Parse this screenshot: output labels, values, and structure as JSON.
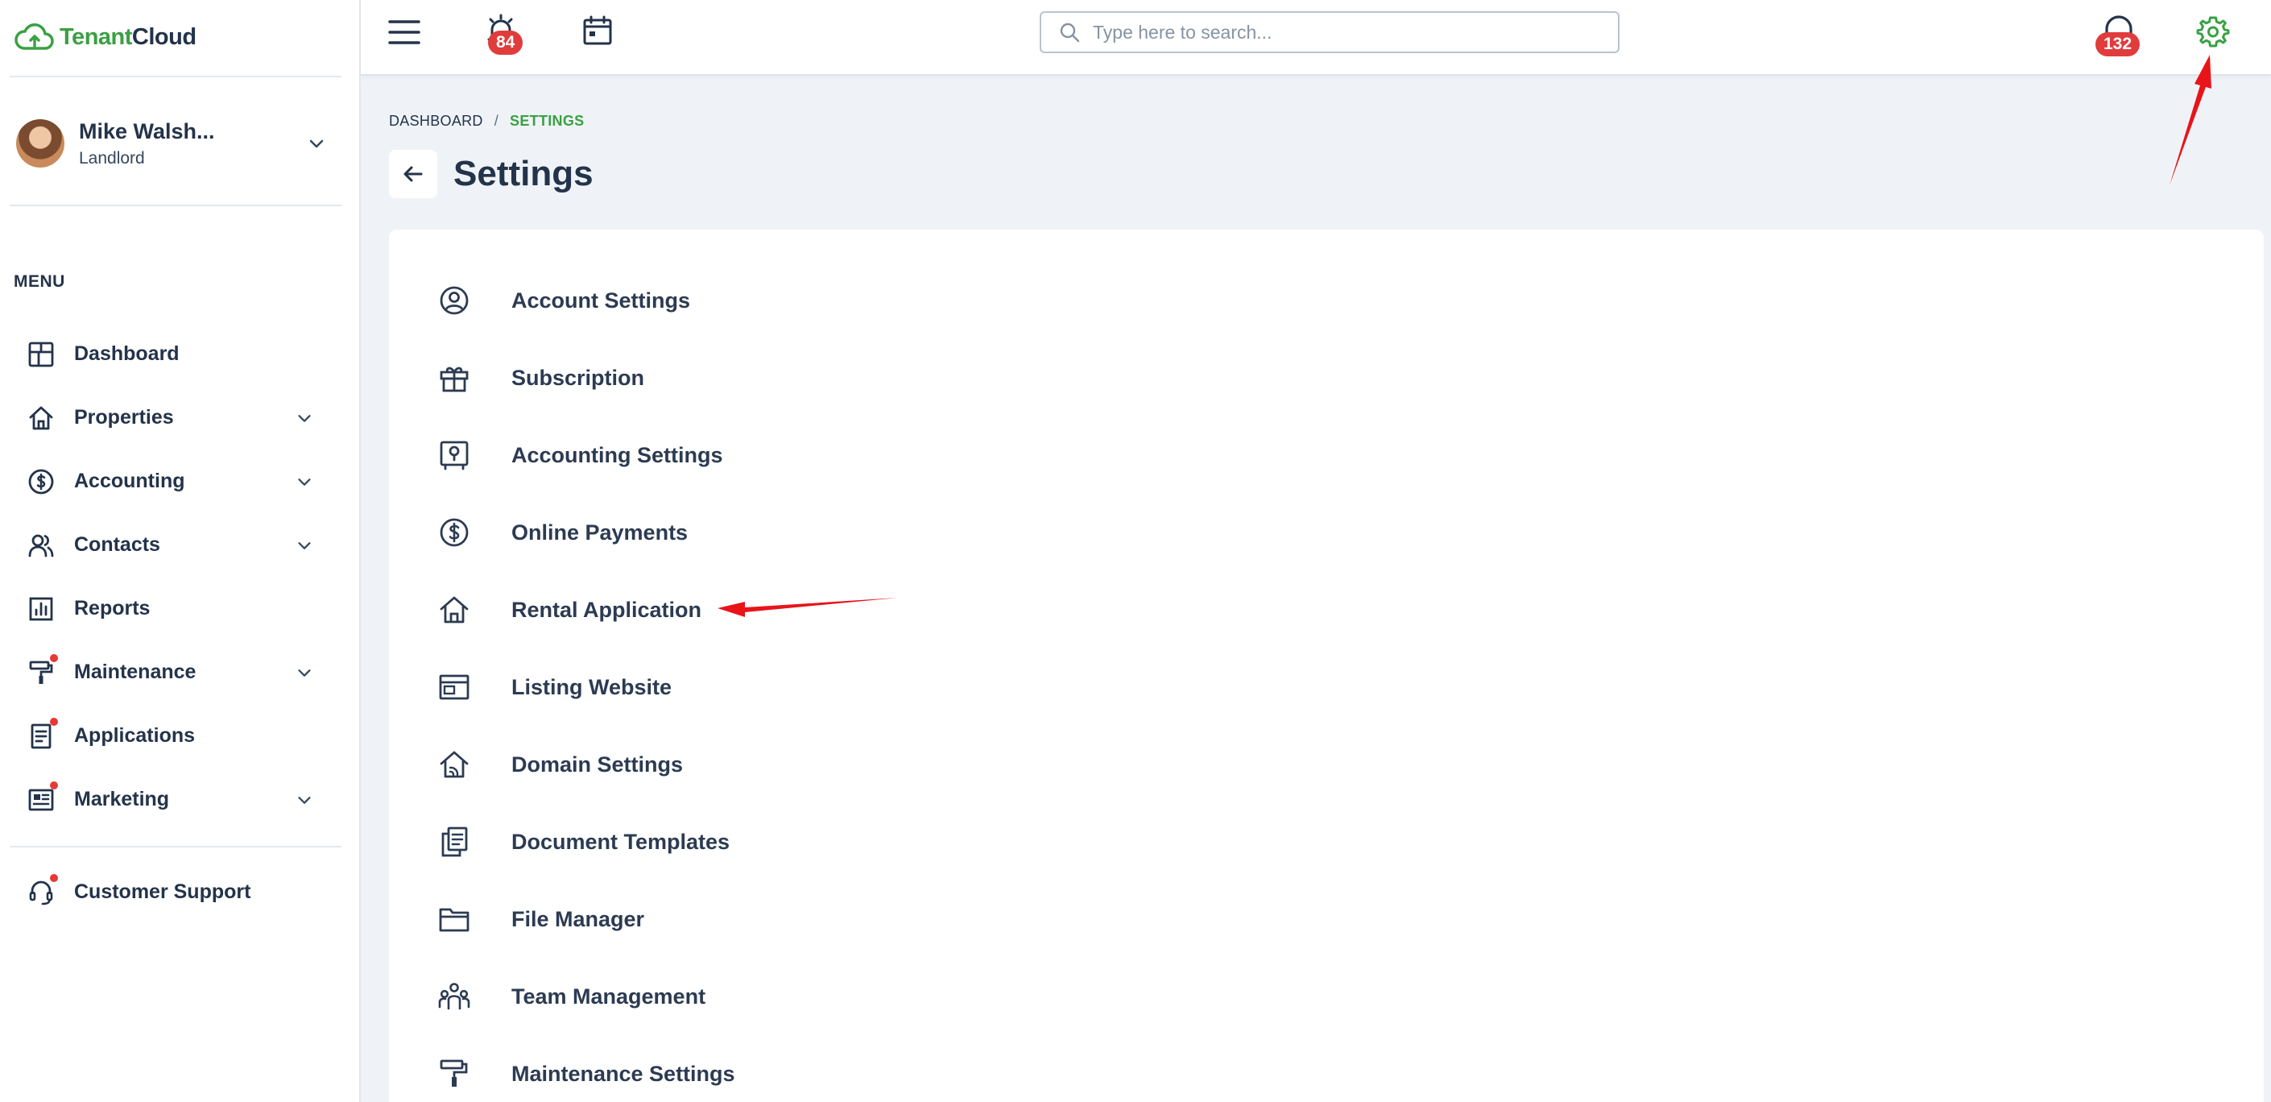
{
  "brand": {
    "logo_part1": "Tenant",
    "logo_part2": "Cloud"
  },
  "user": {
    "name": "Mike Walsh...",
    "role": "Landlord"
  },
  "menu": {
    "label": "MENU",
    "items": [
      {
        "label": "Dashboard",
        "icon": "dashboard-icon",
        "has_chevron": false,
        "dot": false
      },
      {
        "label": "Properties",
        "icon": "home-icon",
        "has_chevron": true,
        "dot": false
      },
      {
        "label": "Accounting",
        "icon": "dollar-icon",
        "has_chevron": true,
        "dot": false
      },
      {
        "label": "Contacts",
        "icon": "users-icon",
        "has_chevron": true,
        "dot": false
      },
      {
        "label": "Reports",
        "icon": "bar-chart-icon",
        "has_chevron": false,
        "dot": false
      },
      {
        "label": "Maintenance",
        "icon": "paint-roller-icon",
        "has_chevron": true,
        "dot": true
      },
      {
        "label": "Applications",
        "icon": "document-icon",
        "has_chevron": false,
        "dot": true
      },
      {
        "label": "Marketing",
        "icon": "newspaper-icon",
        "has_chevron": true,
        "dot": true
      }
    ],
    "support_label": "Customer Support"
  },
  "topbar": {
    "alerts_count": "84",
    "search_placeholder": "Type here to search...",
    "support_count": "132"
  },
  "breadcrumb": {
    "root": "DASHBOARD",
    "separator": "/",
    "current": "SETTINGS"
  },
  "page": {
    "title": "Settings"
  },
  "settings": [
    {
      "label": "Account Settings",
      "icon": "user-circle-icon"
    },
    {
      "label": "Subscription",
      "icon": "gift-icon"
    },
    {
      "label": "Accounting Settings",
      "icon": "safe-icon"
    },
    {
      "label": "Online Payments",
      "icon": "dollar-circle-icon"
    },
    {
      "label": "Rental Application",
      "icon": "home-icon"
    },
    {
      "label": "Listing Website",
      "icon": "browser-window-icon"
    },
    {
      "label": "Domain Settings",
      "icon": "home-signal-icon"
    },
    {
      "label": "Document Templates",
      "icon": "documents-icon"
    },
    {
      "label": "File Manager",
      "icon": "folder-icon"
    },
    {
      "label": "Team Management",
      "icon": "team-icon"
    },
    {
      "label": "Maintenance Settings",
      "icon": "paint-roller-icon"
    }
  ],
  "colors": {
    "brand_green": "#3aa043",
    "text_dark": "#23334a",
    "badge_red": "#e03c3c",
    "annotation_red": "#e8141a",
    "page_bg": "#eff3f7"
  }
}
